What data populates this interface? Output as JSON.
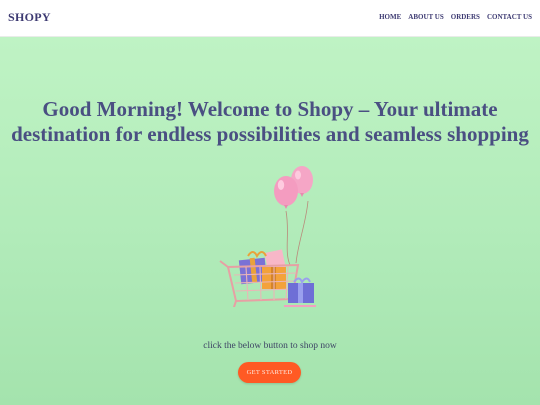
{
  "navbar": {
    "brand": "SHOPY",
    "links": [
      "HOME",
      "ABOUT US",
      "ORDERS",
      "CONTACT US"
    ]
  },
  "hero": {
    "title_line1": "Good Morning! Welcome to Shopy – Your ultimate",
    "title_line2": "destination for endless possibilities and seamless shopping",
    "cta_text": "click the below button to shop now",
    "cta_button": "GET STARTED"
  },
  "colors": {
    "brand": "#3d3a72",
    "hero_background": "#b3edbb",
    "title": "#4a4f82",
    "cta_button": "#ff5a24"
  },
  "icons": [
    "shopping-cart-illustration",
    "balloon-icon",
    "gift-box-icon"
  ]
}
